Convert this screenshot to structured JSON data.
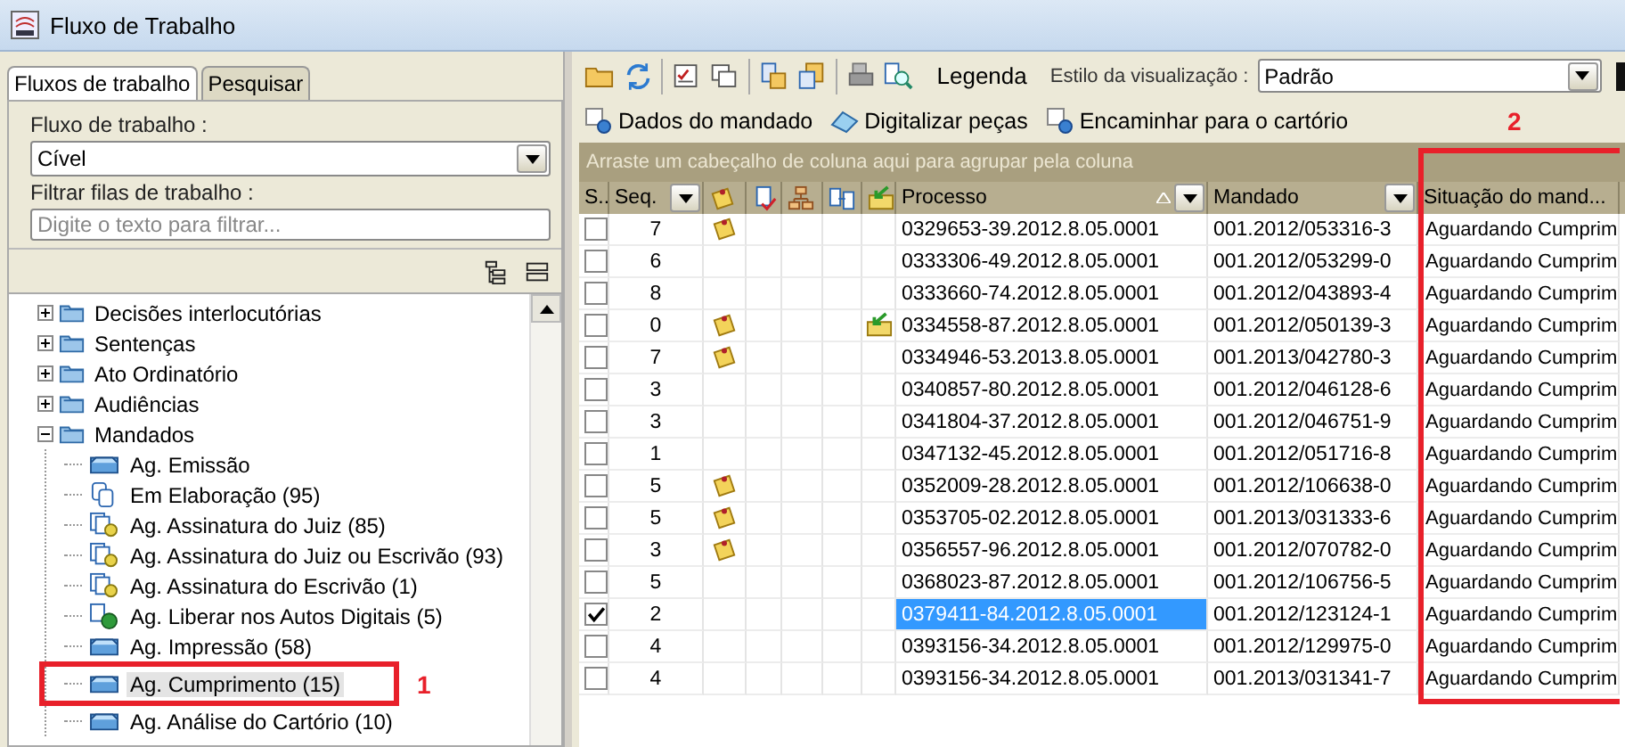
{
  "window": {
    "title": "Fluxo de Trabalho"
  },
  "left_panel": {
    "tabs": [
      {
        "label": "Fluxos de trabalho",
        "selected": true
      },
      {
        "label": "Pesquisar",
        "selected": false
      }
    ],
    "workflow_label": "Fluxo de trabalho :",
    "workflow_value": "Cível",
    "filter_label": "Filtrar filas de trabalho :",
    "filter_placeholder": "Digite o texto para filtrar...",
    "tree": [
      {
        "label": "Decisões interlocutórias",
        "kind": "folder",
        "expanded": false,
        "selected": false
      },
      {
        "label": "Sentenças",
        "kind": "folder",
        "expanded": false,
        "selected": false
      },
      {
        "label": "Ato Ordinatório",
        "kind": "folder",
        "expanded": false,
        "selected": false
      },
      {
        "label": "Audiências",
        "kind": "folder",
        "expanded": false,
        "selected": false
      },
      {
        "label": "Mandados",
        "kind": "folder",
        "expanded": true,
        "selected": false,
        "children": [
          {
            "label": "Ag. Emissão",
            "kind": "tray",
            "selected": false
          },
          {
            "label": "Em Elaboração (95)",
            "kind": "copies",
            "selected": false
          },
          {
            "label": "Ag. Assinatura do Juiz (85)",
            "kind": "seal",
            "selected": false
          },
          {
            "label": "Ag. Assinatura do Juiz ou Escrivão (93)",
            "kind": "seal",
            "selected": false
          },
          {
            "label": "Ag. Assinatura do Escrivão (1)",
            "kind": "seal",
            "selected": false
          },
          {
            "label": "Ag. Liberar nos Autos Digitais (5)",
            "kind": "globe",
            "selected": false
          },
          {
            "label": "Ag. Impressão (58)",
            "kind": "tray",
            "selected": false
          },
          {
            "label": "Ag. Cumprimento (15)",
            "kind": "tray",
            "selected": true,
            "annotation": "1"
          },
          {
            "label": "Ag. Análise do Cartório (10)",
            "kind": "tray",
            "selected": false
          }
        ]
      }
    ]
  },
  "toolbar": {
    "legend": "Legenda",
    "style_label": "Estilo da visualização :",
    "style_value": "Padrão"
  },
  "actions": [
    "Dados do mandado",
    "Digitalizar peças",
    "Encaminhar para o cartório"
  ],
  "group_hint": "Arraste um cabeçalho de coluna aqui para agrupar pela coluna",
  "table": {
    "columns": [
      {
        "kind": "text",
        "label": "S.."
      },
      {
        "kind": "text",
        "label": "Seq.",
        "filter": true
      },
      {
        "kind": "note"
      },
      {
        "kind": "doc-check"
      },
      {
        "kind": "tree"
      },
      {
        "kind": "docs"
      },
      {
        "kind": "return"
      },
      {
        "kind": "text",
        "label": "Processo",
        "filter": true,
        "sorted": true
      },
      {
        "kind": "text",
        "label": "Mandado",
        "filter": true
      },
      {
        "kind": "text",
        "label": "Situação do mand...",
        "filter": false,
        "annotation": "2"
      }
    ],
    "rows": [
      {
        "checked": false,
        "seq": "7",
        "note": true,
        "returned": false,
        "processo": "0329653-39.2012.8.05.0001",
        "mandado": "001.2012/053316-3",
        "situacao": "Aguardando Cumprim",
        "selected": false
      },
      {
        "checked": false,
        "seq": "6",
        "note": false,
        "returned": false,
        "processo": "0333306-49.2012.8.05.0001",
        "mandado": "001.2012/053299-0",
        "situacao": "Aguardando Cumprim",
        "selected": false
      },
      {
        "checked": false,
        "seq": "8",
        "note": false,
        "returned": false,
        "processo": "0333660-74.2012.8.05.0001",
        "mandado": "001.2012/043893-4",
        "situacao": "Aguardando Cumprim",
        "selected": false
      },
      {
        "checked": false,
        "seq": "0",
        "note": true,
        "returned": true,
        "processo": "0334558-87.2012.8.05.0001",
        "mandado": "001.2012/050139-3",
        "situacao": "Aguardando Cumprim",
        "selected": false
      },
      {
        "checked": false,
        "seq": "7",
        "note": true,
        "returned": false,
        "processo": "0334946-53.2013.8.05.0001",
        "mandado": "001.2013/042780-3",
        "situacao": "Aguardando Cumprim",
        "selected": false
      },
      {
        "checked": false,
        "seq": "3",
        "note": false,
        "returned": false,
        "processo": "0340857-80.2012.8.05.0001",
        "mandado": "001.2012/046128-6",
        "situacao": "Aguardando Cumprim",
        "selected": false
      },
      {
        "checked": false,
        "seq": "3",
        "note": false,
        "returned": false,
        "processo": "0341804-37.2012.8.05.0001",
        "mandado": "001.2012/046751-9",
        "situacao": "Aguardando Cumprim",
        "selected": false
      },
      {
        "checked": false,
        "seq": "1",
        "note": false,
        "returned": false,
        "processo": "0347132-45.2012.8.05.0001",
        "mandado": "001.2012/051716-8",
        "situacao": "Aguardando Cumprim",
        "selected": false
      },
      {
        "checked": false,
        "seq": "5",
        "note": true,
        "returned": false,
        "processo": "0352009-28.2012.8.05.0001",
        "mandado": "001.2012/106638-0",
        "situacao": "Aguardando Cumprim",
        "selected": false
      },
      {
        "checked": false,
        "seq": "5",
        "note": true,
        "returned": false,
        "processo": "0353705-02.2012.8.05.0001",
        "mandado": "001.2013/031333-6",
        "situacao": "Aguardando Cumprim",
        "selected": false
      },
      {
        "checked": false,
        "seq": "3",
        "note": true,
        "returned": false,
        "processo": "0356557-96.2012.8.05.0001",
        "mandado": "001.2012/070782-0",
        "situacao": "Aguardando Cumprim",
        "selected": false
      },
      {
        "checked": false,
        "seq": "5",
        "note": false,
        "returned": false,
        "processo": "0368023-87.2012.8.05.0001",
        "mandado": "001.2012/106756-5",
        "situacao": "Aguardando Cumprim",
        "selected": false
      },
      {
        "checked": true,
        "seq": "2",
        "note": false,
        "returned": false,
        "processo": "0379411-84.2012.8.05.0001",
        "mandado": "001.2012/123124-1",
        "situacao": "Aguardando Cumprim",
        "selected": true
      },
      {
        "checked": false,
        "seq": "4",
        "note": false,
        "returned": false,
        "processo": "0393156-34.2012.8.05.0001",
        "mandado": "001.2012/129975-0",
        "situacao": "Aguardando Cumprim",
        "selected": false
      },
      {
        "checked": false,
        "seq": "4",
        "note": false,
        "returned": false,
        "processo": "0393156-34.2012.8.05.0001",
        "mandado": "001.2013/031341-7",
        "situacao": "Aguardando Cumprim",
        "selected": false
      }
    ]
  }
}
